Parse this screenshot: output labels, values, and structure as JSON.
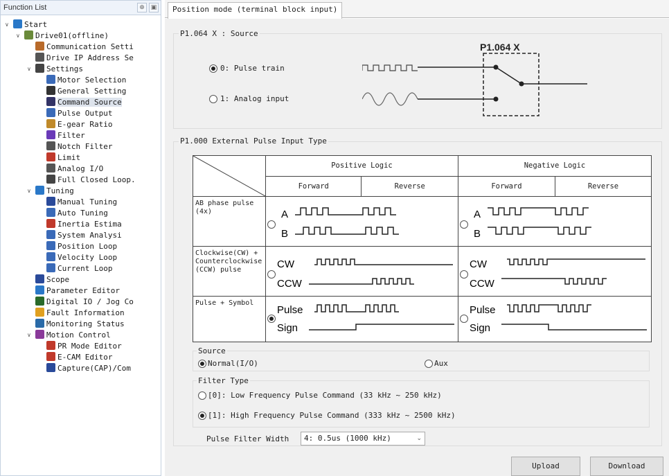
{
  "function_list": {
    "title": "Function List",
    "pin_icon": "pin-icon",
    "close_icon": "dock-icon",
    "tree": [
      {
        "label": "Start",
        "icon": "start-icon"
      },
      {
        "label": "Drive01(offline)",
        "icon": "drive-icon"
      },
      {
        "label": "Communication Setti",
        "icon": "communication-icon"
      },
      {
        "label": "Drive IP Address Se",
        "icon": "ip-address-icon"
      },
      {
        "label": "Settings",
        "icon": "settings-icon"
      },
      {
        "label": "Motor Selection",
        "icon": "motor-icon"
      },
      {
        "label": "General Setting",
        "icon": "gear-icon"
      },
      {
        "label": "Command Source",
        "icon": "command-source-icon"
      },
      {
        "label": "Pulse Output",
        "icon": "pulse-output-icon"
      },
      {
        "label": "E-gear Ratio",
        "icon": "egear-icon"
      },
      {
        "label": "Filter",
        "icon": "filter-icon"
      },
      {
        "label": "Notch Filter",
        "icon": "notch-filter-icon"
      },
      {
        "label": "Limit",
        "icon": "limit-icon"
      },
      {
        "label": "Analog I/O",
        "icon": "analog-icon"
      },
      {
        "label": "Full Closed Loop.",
        "icon": "closed-loop-icon"
      },
      {
        "label": "Tuning",
        "icon": "tuning-icon"
      },
      {
        "label": "Manual Tuning",
        "icon": "manual-tuning-icon"
      },
      {
        "label": "Auto Tuning",
        "icon": "auto-tuning-icon"
      },
      {
        "label": "Inertia Estima",
        "icon": "inertia-icon"
      },
      {
        "label": "System Analysi",
        "icon": "system-analysis-icon"
      },
      {
        "label": "Position Loop",
        "icon": "position-loop-icon"
      },
      {
        "label": "Velocity Loop",
        "icon": "velocity-loop-icon"
      },
      {
        "label": "Current Loop",
        "icon": "current-loop-icon"
      },
      {
        "label": "Scope",
        "icon": "scope-icon"
      },
      {
        "label": "Parameter Editor",
        "icon": "parameter-icon"
      },
      {
        "label": "Digital IO / Jog Co",
        "icon": "digital-io-icon"
      },
      {
        "label": "Fault Information",
        "icon": "warning-icon"
      },
      {
        "label": "Monitoring Status",
        "icon": "monitor-icon"
      },
      {
        "label": "Motion Control",
        "icon": "motion-icon"
      },
      {
        "label": "PR Mode Editor",
        "icon": "pr-mode-icon"
      },
      {
        "label": "E-CAM Editor",
        "icon": "ecam-icon"
      },
      {
        "label": "Capture(CAP)/Com",
        "icon": "capture-icon"
      }
    ]
  },
  "tab": {
    "label": "Position mode (terminal block input)"
  },
  "source_group": {
    "title": "P1.064 X : Source",
    "diagram_label": "P1.064 X",
    "option0": "0: Pulse train",
    "option1": "1: Analog input",
    "selected": 0
  },
  "pulse_type_group": {
    "title": "P1.000 External Pulse Input Type",
    "positive_logic": "Positive Logic",
    "negative_logic": "Negative Logic",
    "forward": "Forward",
    "reverse": "Reverse",
    "row1_label": "AB phase pulse (4x)",
    "row2_label": "Clockwise(CW) + Counterclockwise (CCW) pulse",
    "row3_label": "Pulse + Symbol",
    "sig_a": "A",
    "sig_b": "B",
    "sig_cw": "CW",
    "sig_ccw": "CCW",
    "sig_pulse": "Pulse",
    "sig_sign": "Sign",
    "selected_row": 3,
    "selected_logic": "positive"
  },
  "source2": {
    "title": "Source",
    "normal": "Normal(I/O)",
    "aux": "Aux",
    "selected": "normal"
  },
  "filter_type": {
    "title": "Filter Type",
    "opt0": "[0]: Low Frequency Pulse Command (33 kHz ~ 250 kHz)",
    "opt1": "[1]: High Frequency Pulse Command (333 kHz ~ 2500 kHz)",
    "selected": 1
  },
  "pulse_filter": {
    "label": "Pulse Filter Width",
    "value": "4: 0.5us (1000 kHz)"
  },
  "buttons": {
    "upload": "Upload",
    "download": "Download"
  },
  "colors": {
    "accent": "#1f6fbf",
    "panel": "#f0f0f0",
    "selection": "#dde3ec"
  }
}
